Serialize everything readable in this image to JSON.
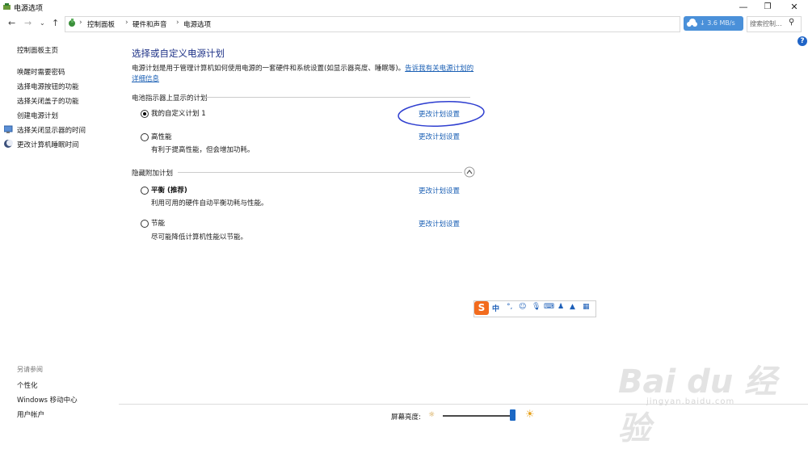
{
  "window": {
    "title": "电源选项"
  },
  "nav": {
    "breadcrumbs": [
      "控制面板",
      "硬件和声音",
      "电源选项"
    ],
    "speed": "3.6 MB/s",
    "search_placeholder": "搜索控制..."
  },
  "sidebar": {
    "items": [
      "控制面板主页",
      "唤醒时需要密码",
      "选择电源按钮的功能",
      "选择关闭盖子的功能",
      "创建电源计划",
      "选择关闭显示器的时间",
      "更改计算机睡眠时间"
    ],
    "see_also_title": "另请参阅",
    "see_also": [
      "个性化",
      "Windows 移动中心",
      "用户帐户"
    ]
  },
  "main": {
    "title": "选择或自定义电源计划",
    "description": "电源计划是用于管理计算机如何使用电源的一套硬件和系统设置(如显示器亮度、睡眠等)。",
    "description_link": "告诉我有关电源计划的详细信息",
    "section_battery": "电池指示器上显示的计划",
    "section_hidden": "隐藏附加计划",
    "plans": [
      {
        "name": "我的自定义计划 1",
        "desc": "",
        "link": "更改计划设置",
        "selected": true
      },
      {
        "name": "高性能",
        "desc": "有利于提高性能，但会增加功耗。",
        "link": "更改计划设置",
        "selected": false
      },
      {
        "name": "平衡 (推荐)",
        "desc": "利用可用的硬件自动平衡功耗与性能。",
        "link": "更改计划设置",
        "selected": false
      },
      {
        "name": "节能",
        "desc": "尽可能降低计算机性能以节能。",
        "link": "更改计划设置",
        "selected": false
      }
    ]
  },
  "ime": {
    "mode": "中"
  },
  "footer": {
    "brightness_label": "屏幕亮度:",
    "brightness_level": 0.96
  },
  "watermark": {
    "brand": "Bai du 经验",
    "url": "jingyan.baidu.com"
  },
  "colors": {
    "accent": "#1a5fb4",
    "title": "#1e3287",
    "annotation": "#2f3fd0"
  }
}
